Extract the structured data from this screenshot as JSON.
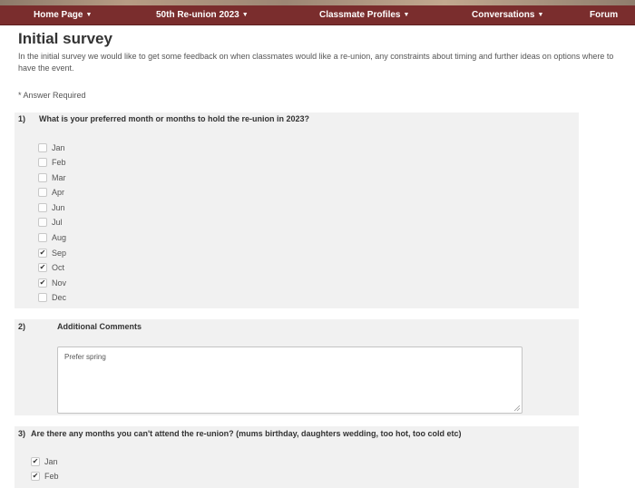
{
  "nav": {
    "items": [
      {
        "label": "Home Page",
        "caret": "▼"
      },
      {
        "label": "50th Re-union 2023",
        "caret": "▼"
      },
      {
        "label": "Classmate Profiles",
        "caret": "▼"
      },
      {
        "label": "Conversations",
        "caret": "▼"
      },
      {
        "label": "Forum",
        "caret": ""
      }
    ]
  },
  "page": {
    "title": "Initial survey",
    "intro": "In the initial survey we would like to get some feedback on when classmates would like a re-union, any constraints about timing and further ideas on options where to have the event.",
    "required_note": "* Answer Required"
  },
  "questions": {
    "q1": {
      "number": "1)",
      "text": "What is your preferred month or months to hold the re-union in 2023?",
      "options": [
        {
          "label": "Jan",
          "checked": false
        },
        {
          "label": "Feb",
          "checked": false
        },
        {
          "label": "Mar",
          "checked": false
        },
        {
          "label": "Apr",
          "checked": false
        },
        {
          "label": "Jun",
          "checked": false
        },
        {
          "label": "Jul",
          "checked": false
        },
        {
          "label": "Aug",
          "checked": false
        },
        {
          "label": "Sep",
          "checked": true
        },
        {
          "label": "Oct",
          "checked": true
        },
        {
          "label": "Nov",
          "checked": true
        },
        {
          "label": "Dec",
          "checked": false
        }
      ]
    },
    "q2": {
      "number": "2)",
      "text": "Additional Comments",
      "value": "Prefer spring"
    },
    "q3": {
      "number": "3)",
      "text": "Are there any months you can't attend the re-union? (mums birthday, daughters wedding, too hot, too cold etc)",
      "options": [
        {
          "label": "Jan",
          "checked": true
        },
        {
          "label": "Feb",
          "checked": true
        }
      ]
    }
  },
  "colors": {
    "nav_bg": "#7a2d2d",
    "panel_bg": "#f1f1f1"
  },
  "icons": {
    "check": "check-icon",
    "caret": "caret-down-icon",
    "resize": "resize-grip-icon"
  }
}
